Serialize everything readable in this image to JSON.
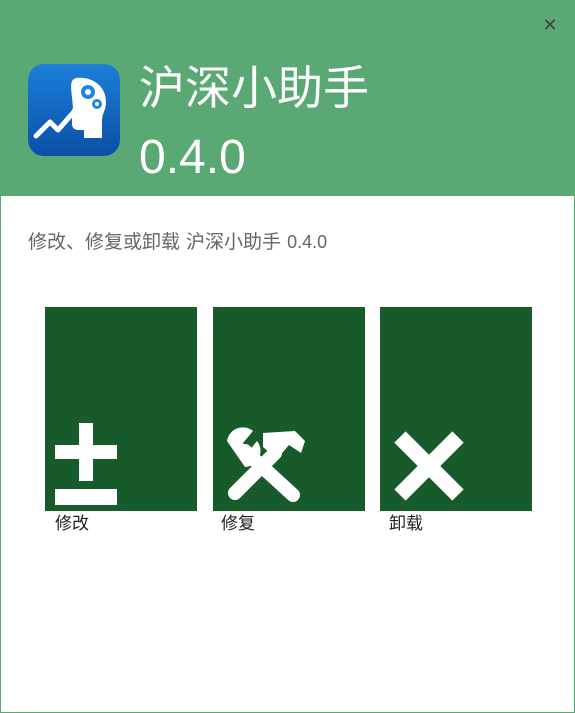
{
  "window": {
    "close_glyph": "✕",
    "title": "沪深小助手",
    "version": "0.4.0"
  },
  "subtitle": {
    "text": "修改、修复或卸载 沪深小助手",
    "version": "0.4.0"
  },
  "actions": [
    {
      "label": "修改",
      "icon": "plus-minus-icon"
    },
    {
      "label": "修复",
      "icon": "hammer-wrench-icon"
    },
    {
      "label": "卸载",
      "icon": "x-icon"
    }
  ],
  "colors": {
    "header_bg": "#5aa873",
    "tile_bg": "#175b2b",
    "icon_blue": "#0b66c2"
  }
}
